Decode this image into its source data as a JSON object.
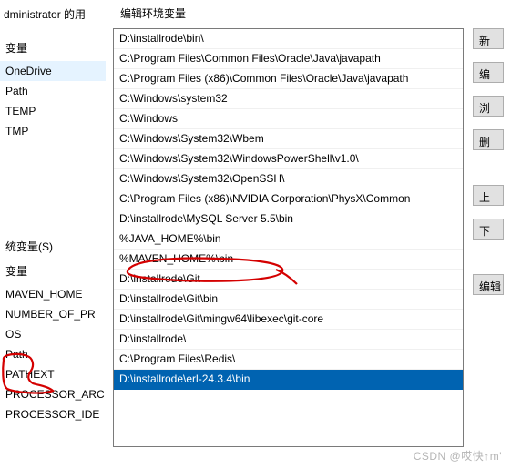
{
  "bg": {
    "title_fragment": "dministrator 的用",
    "header_var": "变量",
    "user_vars": [
      "OneDrive",
      "Path",
      "TEMP",
      "TMP"
    ],
    "sys_header": "统变量(S)",
    "sys_vars": [
      "MAVEN_HOME",
      "NUMBER_OF_PR",
      "OS",
      "Path",
      "PATHEXT",
      "PROCESSOR_ARC",
      "PROCESSOR_IDE"
    ]
  },
  "dialog": {
    "title": "编辑环境变量",
    "paths": [
      "D:\\installrode\\bin\\",
      "C:\\Program Files\\Common Files\\Oracle\\Java\\javapath",
      "C:\\Program Files (x86)\\Common Files\\Oracle\\Java\\javapath",
      "C:\\Windows\\system32",
      "C:\\Windows",
      "C:\\Windows\\System32\\Wbem",
      "C:\\Windows\\System32\\WindowsPowerShell\\v1.0\\",
      "C:\\Windows\\System32\\OpenSSH\\",
      "C:\\Program Files (x86)\\NVIDIA Corporation\\PhysX\\Common",
      "D:\\installrode\\MySQL Server 5.5\\bin",
      "%JAVA_HOME%\\bin",
      "%MAVEN_HOME%\\bin",
      "D:\\installrode\\Git",
      "D:\\installrode\\Git\\bin",
      "D:\\installrode\\Git\\mingw64\\libexec\\git-core",
      "D:\\installrode\\",
      "C:\\Program Files\\Redis\\",
      "D:\\installrode\\erl-24.3.4\\bin"
    ],
    "selected_index": 17,
    "buttons": {
      "new": "新",
      "edit": "编",
      "browse": "浏",
      "delete": "删",
      "up": "上",
      "down": "下",
      "edit_text": "编辑"
    }
  },
  "watermark": "CSDN @哎快↑m'"
}
